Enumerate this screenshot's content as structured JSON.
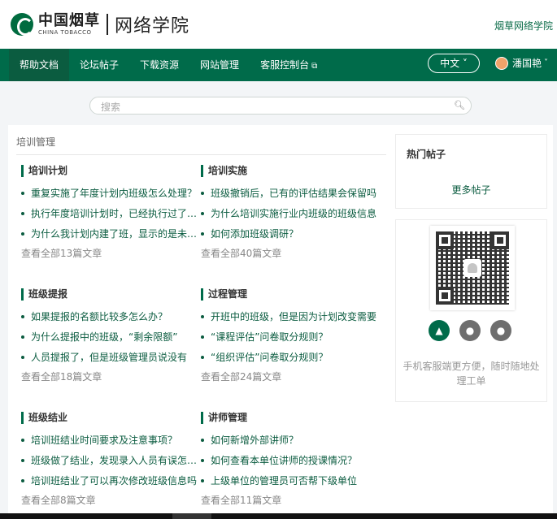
{
  "header": {
    "logo_cn": "中国烟草",
    "logo_en": "CHINA TOBACCO",
    "logo_school": "网络学院",
    "top_link": "烟草网络学院"
  },
  "nav": {
    "items": [
      {
        "label": "帮助文档"
      },
      {
        "label": "论坛帖子"
      },
      {
        "label": "下载资源"
      },
      {
        "label": "网站管理"
      },
      {
        "label": "客服控制台"
      }
    ],
    "language": "中文",
    "user_name": "潘国艳"
  },
  "search": {
    "placeholder": "搜索"
  },
  "breadcrumb": "培训管理",
  "categories": [
    {
      "title": "培训计划",
      "items": [
        "重复实施了年度计划内班级怎么处理？",
        "执行年度培训计划时，已经执行过了怎么办",
        "为什么我计划内建了班，显示的是未实施"
      ],
      "more": "查看全部13篇文章"
    },
    {
      "title": "培训实施",
      "items": [
        "班级撤销后，已有的评估结果会保留吗",
        "为什么培训实施行业内班级的班级信息",
        "如何添加班级调研？"
      ],
      "more": "查看全部40篇文章"
    },
    {
      "title": "班级提报",
      "items": [
        "如果提报的名额比较多怎么办？",
        "为什么提报中的班级，“剩余限额”",
        "人员提报了，但是班级管理员说没有"
      ],
      "more": "查看全部18篇文章"
    },
    {
      "title": "过程管理",
      "items": [
        "开班中的班级，但是因为计划改变需要",
        "“课程评估”问卷取分规则？",
        "“组织评估”问卷取分规则？"
      ],
      "more": "查看全部24篇文章"
    },
    {
      "title": "班级结业",
      "items": [
        "培训班结业时间要求及注意事项？",
        "班级做了结业，发现录入人员有误怎么办",
        "培训班结业了可以再次修改班级信息吗"
      ],
      "more": "查看全部8篇文章"
    },
    {
      "title": "讲师管理",
      "items": [
        "如何新增外部讲师？",
        "如何查看本单位讲师的授课情况？",
        "上级单位的管理员可否帮下级单位"
      ],
      "more": "查看全部11篇文章"
    }
  ],
  "sidebar": {
    "hot_title": "热门帖子",
    "more_posts": "更多帖子",
    "app_tip": "手机客服端更方便，随时随地处理工单"
  },
  "colors": {
    "brand": "#006b4a",
    "link": "#0b5c40"
  }
}
